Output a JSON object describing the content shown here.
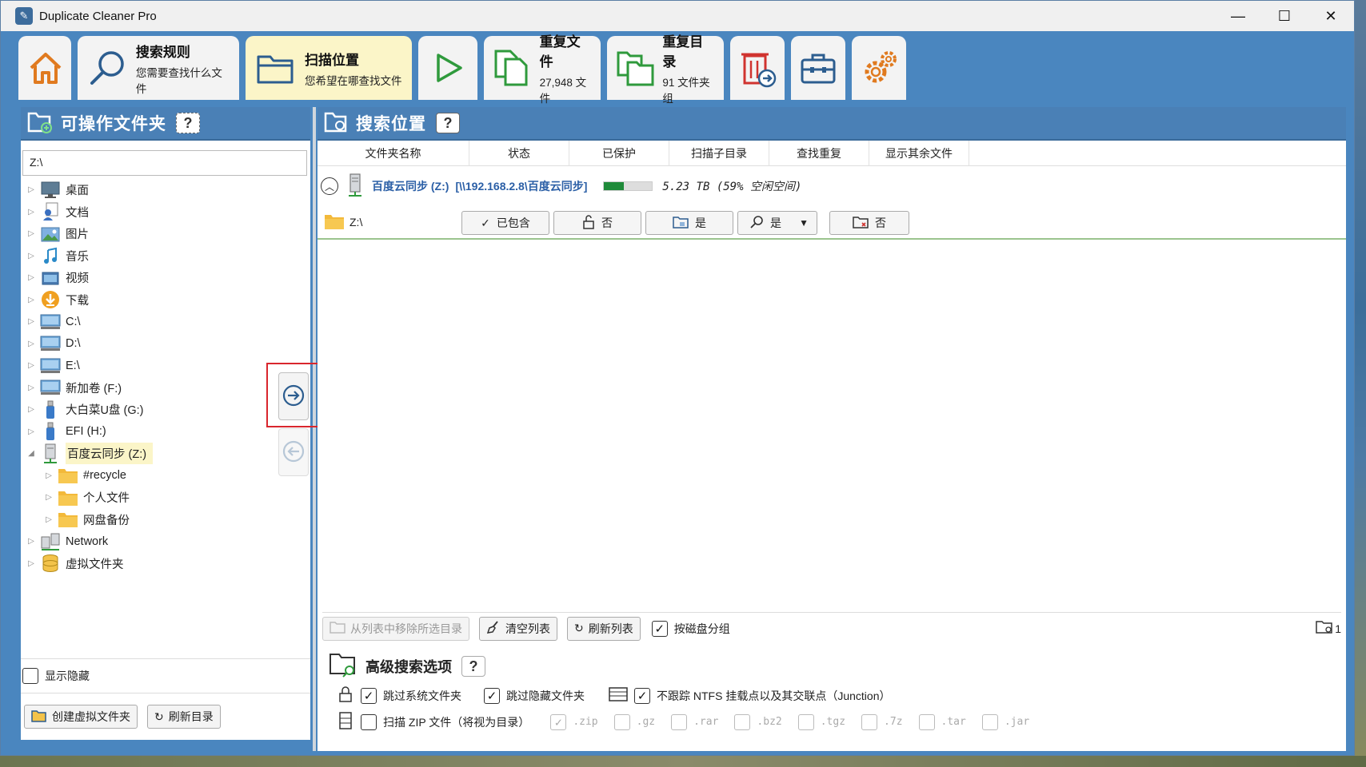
{
  "window": {
    "title": "Duplicate Cleaner Pro",
    "minimize": "—",
    "maximize": "☐",
    "close": "✕"
  },
  "toolbar": {
    "search_rules": {
      "title": "搜索规则",
      "subtitle": "您需要查找什么文件"
    },
    "scan_location": {
      "title": "扫描位置",
      "subtitle": "您希望在哪查找文件"
    },
    "dup_files": {
      "title": "重复文件",
      "subtitle": "27,948 文件"
    },
    "dup_dirs": {
      "title": "重复目录",
      "subtitle": "91 文件夹组"
    }
  },
  "left": {
    "title": "可操作文件夹",
    "help": "?",
    "path": "Z:\\",
    "tree": [
      {
        "label": "桌面",
        "icon": "desktop-icon"
      },
      {
        "label": "文档",
        "icon": "documents-icon"
      },
      {
        "label": "图片",
        "icon": "pictures-icon"
      },
      {
        "label": "音乐",
        "icon": "music-icon"
      },
      {
        "label": "视频",
        "icon": "video-icon"
      },
      {
        "label": "下载",
        "icon": "download-icon"
      },
      {
        "label": "C:\\",
        "icon": "drive-icon"
      },
      {
        "label": "D:\\",
        "icon": "drive-icon"
      },
      {
        "label": "E:\\",
        "icon": "drive-icon"
      },
      {
        "label": "新加卷 (F:)",
        "icon": "drive-icon"
      },
      {
        "label": "大白菜U盘 (G:)",
        "icon": "usb-icon"
      },
      {
        "label": "EFI (H:)",
        "icon": "usb-icon"
      },
      {
        "label": "百度云同步 (Z:)",
        "icon": "network-drive-icon"
      },
      {
        "label": "#recycle",
        "icon": "folder-icon"
      },
      {
        "label": "个人文件",
        "icon": "folder-icon"
      },
      {
        "label": "网盘备份",
        "icon": "folder-icon"
      },
      {
        "label": "Network",
        "icon": "network-icon"
      },
      {
        "label": "虚拟文件夹",
        "icon": "virtual-folder-icon"
      }
    ],
    "show_hidden": "显示隐藏",
    "create_virtual": "创建虚拟文件夹",
    "refresh_dir": "刷新目录"
  },
  "right": {
    "title": "搜索位置",
    "help": "?",
    "columns": [
      "文件夹名称",
      "状态",
      "已保护",
      "扫描子目录",
      "查找重复",
      "显示其余文件"
    ],
    "drive": {
      "name": "百度云同步 (Z:)",
      "unc": "[\\\\192.168.2.8\\百度云同步]",
      "used_fraction": 0.41,
      "size": "5.23 TB (59% 空闲空间)"
    },
    "folder": {
      "name": "Z:\\",
      "status": "已包含",
      "protected": "否",
      "subdirs": "是",
      "find_dup": "是",
      "show_rest": "否"
    },
    "actions": {
      "remove": "从列表中移除所选目录",
      "clear": "清空列表",
      "refresh": "刷新列表",
      "group": "按磁盘分组",
      "count": "1"
    },
    "advanced": {
      "title": "高级搜索选项",
      "help": "?",
      "skip_system": "跳过系统文件夹",
      "skip_hidden": "跳过隐藏文件夹",
      "ntfs": "不跟踪 NTFS 挂载点以及其交联点（Junction）",
      "zip": "扫描 ZIP 文件（将视为目录）",
      "exts": [
        ".zip",
        ".gz",
        ".rar",
        ".bz2",
        ".tgz",
        ".7z",
        ".tar",
        ".jar"
      ]
    }
  }
}
